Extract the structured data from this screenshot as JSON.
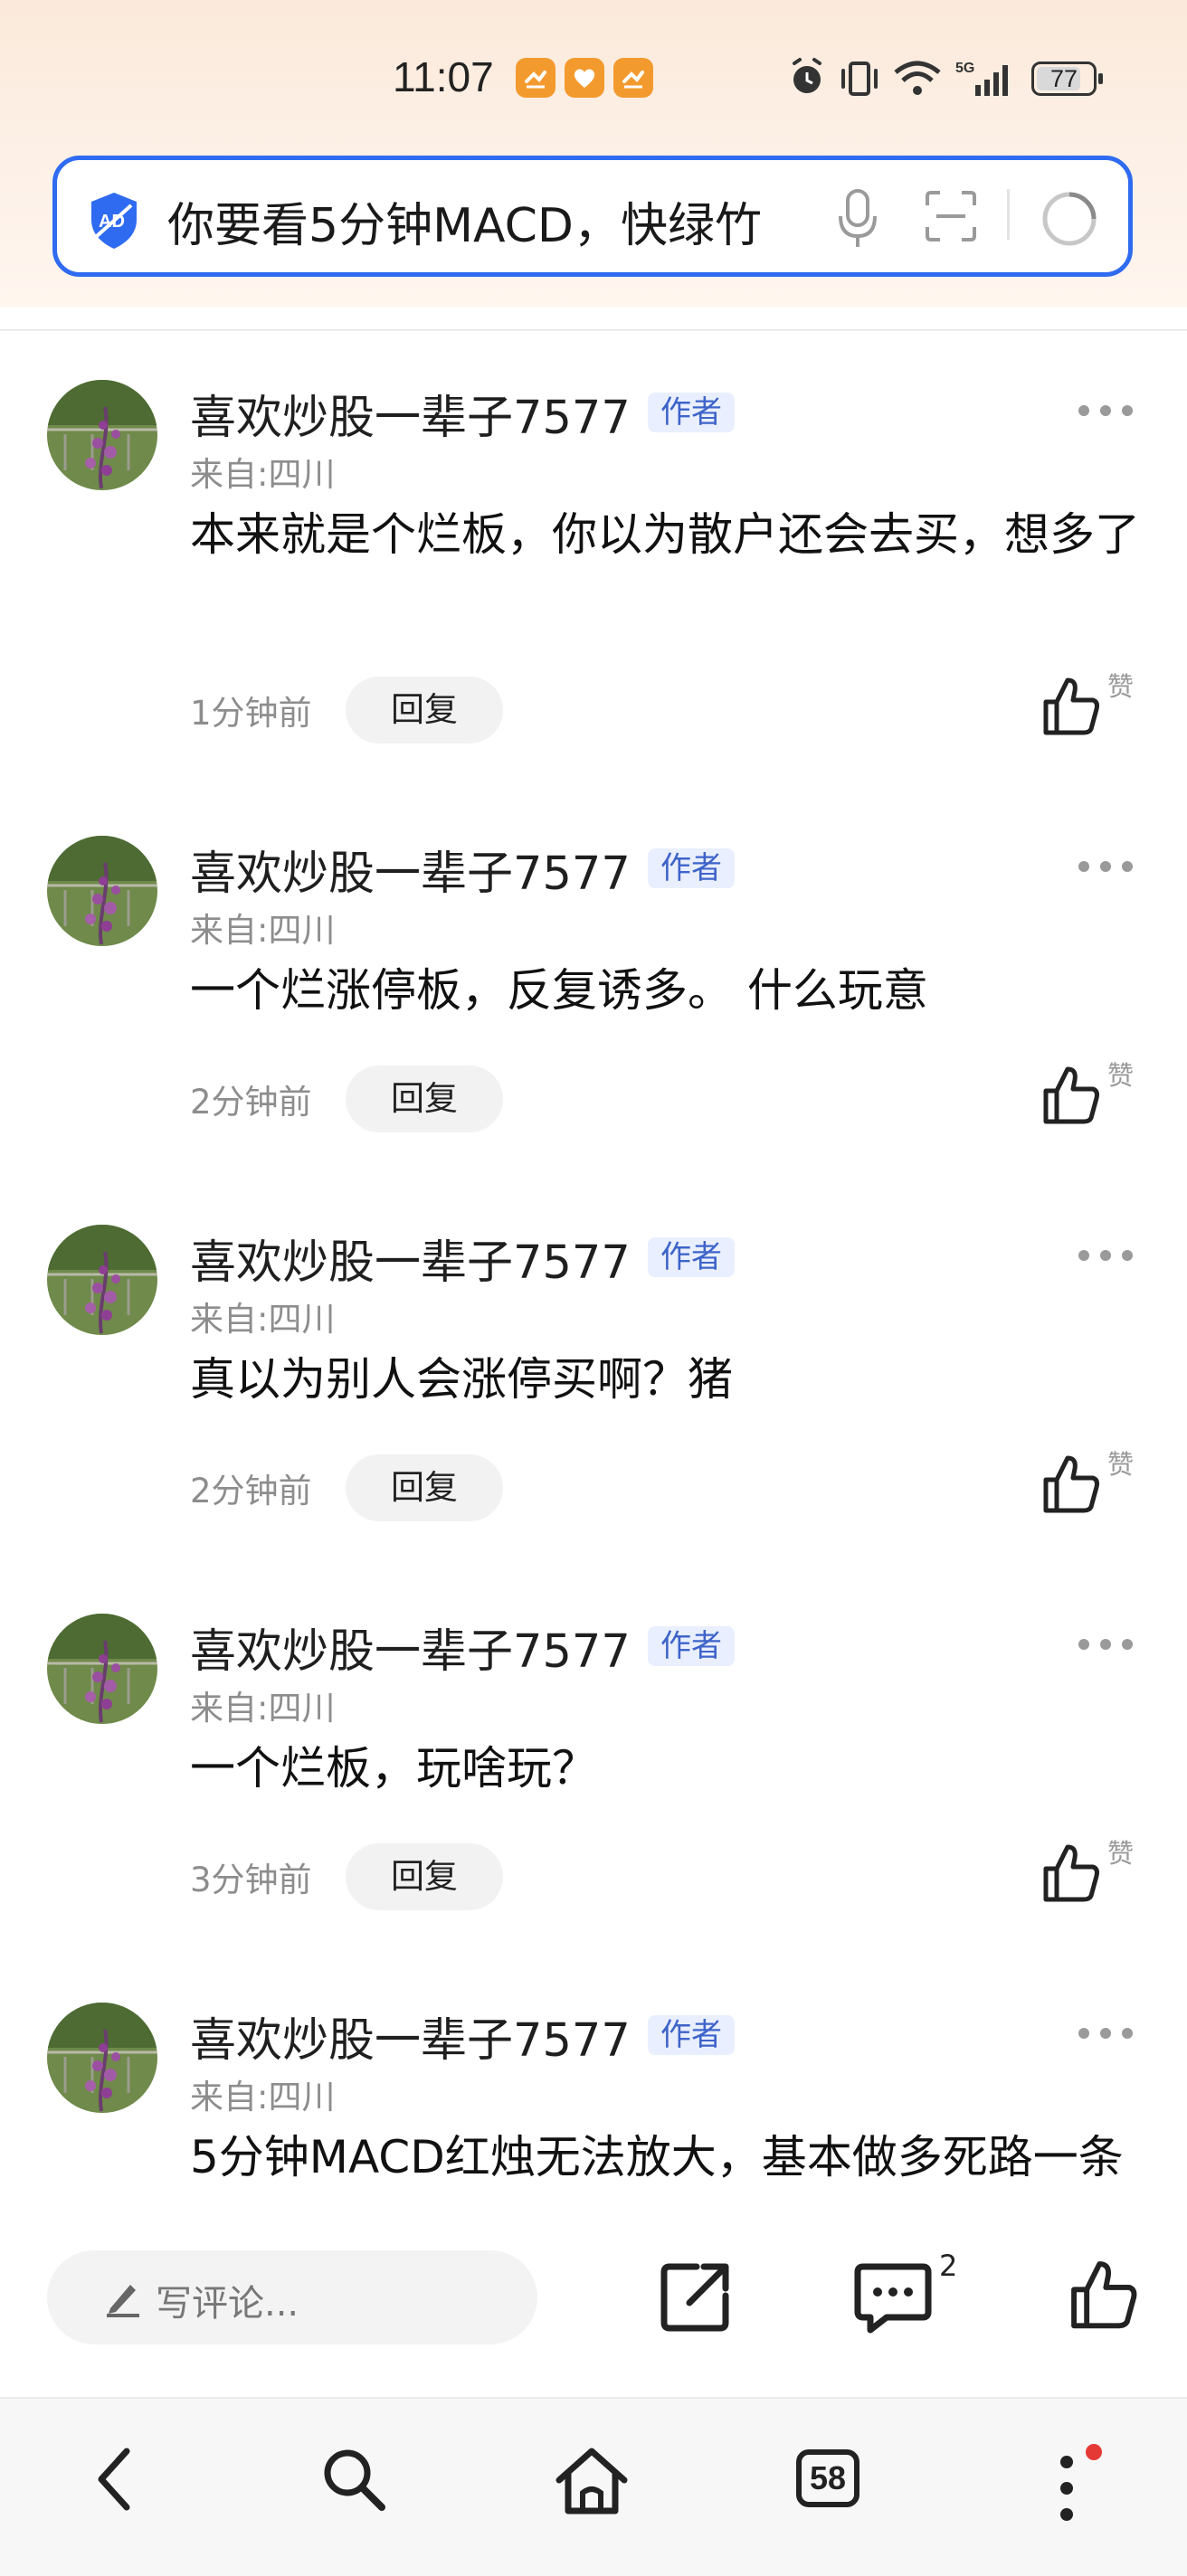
{
  "status_bar": {
    "time": "11:07",
    "battery": "77"
  },
  "search": {
    "query": "你要看5分钟MACD，快绿竹"
  },
  "comments": [
    {
      "username": "喜欢炒股一辈子7577",
      "tag": "作者",
      "location": "来自:四川",
      "text": "本来就是个烂板，你以为散户还会去买，想多了",
      "time": "1分钟前",
      "reply_label": "回复",
      "like_label": "赞"
    },
    {
      "username": "喜欢炒股一辈子7577",
      "tag": "作者",
      "location": "来自:四川",
      "text": "一个烂涨停板，反复诱多。 什么玩意",
      "time": "2分钟前",
      "reply_label": "回复",
      "like_label": "赞"
    },
    {
      "username": "喜欢炒股一辈子7577",
      "tag": "作者",
      "location": "来自:四川",
      "text": "真以为别人会涨停买啊？猪",
      "time": "2分钟前",
      "reply_label": "回复",
      "like_label": "赞"
    },
    {
      "username": "喜欢炒股一辈子7577",
      "tag": "作者",
      "location": "来自:四川",
      "text": "一个烂板，玩啥玩？",
      "time": "3分钟前",
      "reply_label": "回复",
      "like_label": "赞"
    },
    {
      "username": "喜欢炒股一辈子7577",
      "tag": "作者",
      "location": "来自:四川",
      "text": "5分钟MACD红烛无法放大，基本做多死路一条"
    }
  ],
  "action_bar": {
    "comment_placeholder": "写评论...",
    "comment_count": "2"
  },
  "bottom_nav": {
    "tabs_count": "58"
  },
  "colors": {
    "accent": "#2f6bf0",
    "author_tag_bg": "#e9efff",
    "author_tag_text": "#3e64c9",
    "badge_red": "#e53935"
  }
}
